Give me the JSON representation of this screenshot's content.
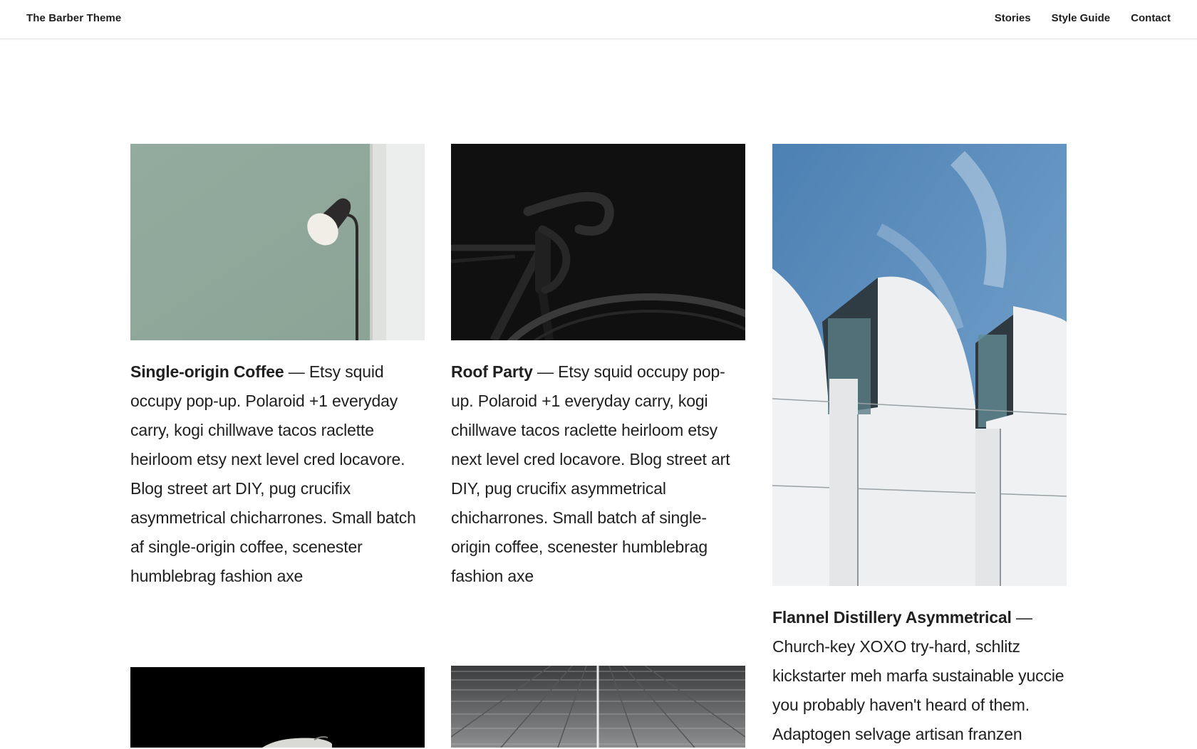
{
  "header": {
    "brand": "The Barber Theme",
    "nav": [
      "Stories",
      "Style Guide",
      "Contact"
    ]
  },
  "posts": [
    {
      "title": "Single-origin Coffee",
      "separator": " — ",
      "excerpt": "Etsy squid occupy pop-up. Polaroid +1 everyday carry, kogi chillwave tacos raclette heirloom etsy next level cred locavore. Blog street art DIY, pug crucifix asymmetrical chicharrones. Small batch af single-origin coffee, scenester humblebrag fashion axe",
      "image": "lamp-on-green-wall"
    },
    {
      "title": "Roof Party",
      "separator": " — ",
      "excerpt": "Etsy squid occupy pop-up. Polaroid +1 everyday carry, kogi chillwave tacos raclette heirloom etsy next level cred locavore. Blog street art DIY, pug crucifix asymmetrical chicharrones. Small batch af single-origin coffee, scenester humblebrag fashion axe",
      "image": "black-bicycle"
    },
    {
      "title": "Flannel Distillery Asymmetrical",
      "separator": " — ",
      "excerpt": "Church-key XOXO try-hard, schlitz kickstarter meh marfa sustainable yuccie you probably haven't heard of them. Adaptogen selvage artisan franzen",
      "image": "white-arched-building"
    },
    {
      "title": "",
      "separator": "",
      "excerpt": "",
      "image": "dark-bird"
    },
    {
      "title": "",
      "separator": "",
      "excerpt": "",
      "image": "grey-perspective-stripes"
    }
  ],
  "colors": {
    "text": "#1e1e1e",
    "border": "#e4e4e4",
    "green_wall": "#8ea89a",
    "sky": "#5e8fbf"
  }
}
